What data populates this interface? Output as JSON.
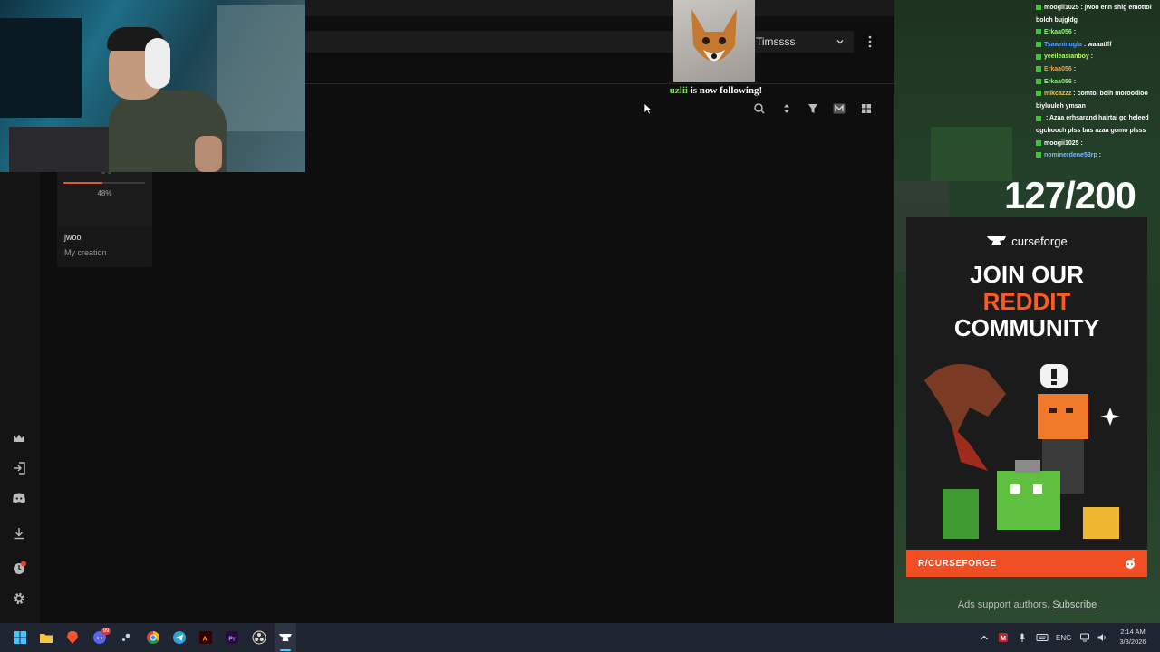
{
  "app": {
    "user_select": {
      "label": "Timssss"
    },
    "creation_card": {
      "status_text": "Downloading game...",
      "progress_percent": 48,
      "progress_label": "48%",
      "name": "jwoo",
      "subtitle": "My creation"
    }
  },
  "overlay": {
    "follow_alert": {
      "follower": "uzlii",
      "message": " is now following!"
    },
    "goal": "127/200"
  },
  "chat": [
    {
      "user": "moogii1025",
      "user_color": "#ffffff",
      "text": "jwoo enn shig emottoi bolch bujgldg"
    },
    {
      "user": "Erkaa056",
      "user_color": "#8ef77e",
      "text": ""
    },
    {
      "user": "Tsawninugla",
      "user_color": "#5aa0ff",
      "text": "waaatfff"
    },
    {
      "user": "yeeileasianboy",
      "user_color": "#b2f56c",
      "text": ""
    },
    {
      "user": "Erkaa056",
      "user_color": "#f0a040",
      "text": ""
    },
    {
      "user": "Erkaa056",
      "user_color": "#8ef77e",
      "text": ""
    },
    {
      "user": "mikcazzz",
      "user_color": "#f0c040",
      "text": "comtoi bolh moroodloo biyluuleh ymsan"
    },
    {
      "user": "",
      "user_color": "#ff3030",
      "text": "Azaa erhsarand hairtai gd heleed ogchooch plss bas azaa gomo plsss"
    },
    {
      "user": "moogii1025",
      "user_color": "#ffffff",
      "text": ""
    },
    {
      "user": "nominerdene53rp",
      "user_color": "#7ab8ff",
      "text": ""
    }
  ],
  "ad": {
    "brand": "curseforge",
    "headline_1": "JOIN OUR",
    "headline_2": "REDDIT",
    "headline_3": "COMMUNITY",
    "cta": "R/CURSEFORGE",
    "footer_text": "Ads support authors.",
    "footer_link": "Subscribe",
    "accent_color": "#f04e23"
  },
  "taskbar": {
    "discord_badge": "99",
    "language": "ENG",
    "time": "2:14 AM",
    "date": "3/3/2026"
  }
}
